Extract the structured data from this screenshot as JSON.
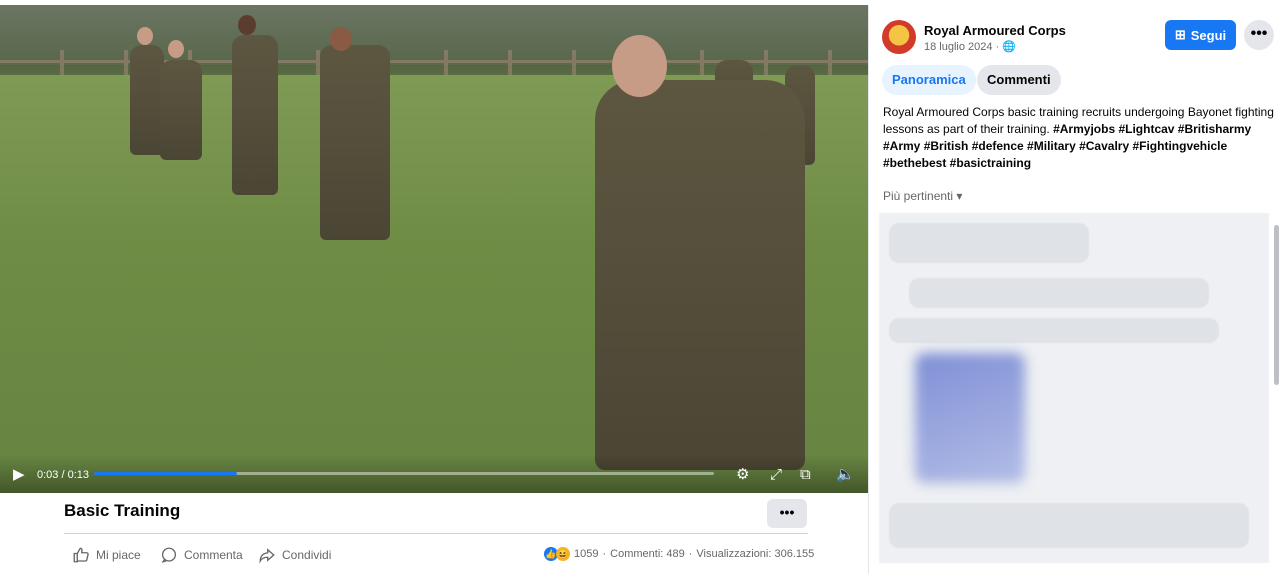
{
  "video": {
    "time": "0:03 / 0:13",
    "progress": 0.23
  },
  "post": {
    "title": "Basic Training",
    "more_label": "•••",
    "actions": {
      "like": "Mi piace",
      "comment": "Commenta",
      "share": "Condividi"
    },
    "stats": {
      "reactions": "1059",
      "comments": "Commenti: 489",
      "views": "Visualizzazioni: 306.155",
      "separator": "·"
    }
  },
  "sidebar": {
    "page_name": "Royal Armoured Corps",
    "date": "18 luglio 2024 ·",
    "follow_label": "Segui",
    "more_label": "•••",
    "tabs": [
      {
        "label": "Panoramica"
      },
      {
        "label": "Commenti"
      }
    ],
    "description": "Royal Armoured Corps basic training recruits undergoing Bayonet fighting lessons as part of their training. ",
    "hashtags": "#Armyjobs #Lightcav #Britisharmy #Army #British #defence #Military #Cavalry #Fightingvehicle #bethebest #basictraining",
    "sort_label": "Più pertinenti"
  },
  "colors": {
    "accent": "#1877f2",
    "tab_active_bg": "#e7f3ff",
    "button_grey": "#e4e6eb"
  }
}
